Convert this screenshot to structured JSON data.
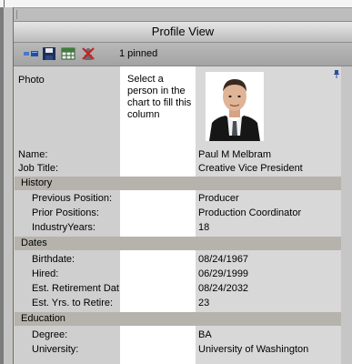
{
  "window": {
    "title": "Profile View"
  },
  "toolbar": {
    "pinned_label": "1 pinned"
  },
  "compare_column": {
    "instruction": "Select a person in the chart to fill this column"
  },
  "profile": {
    "photo_label": "Photo",
    "fields": [
      {
        "label": "Name:",
        "value": "Paul M Melbram"
      },
      {
        "label": "Job Title:",
        "value": "Creative Vice President"
      }
    ],
    "sections": [
      {
        "title": "History",
        "rows": [
          {
            "label": "Previous Position:",
            "value": "Producer"
          },
          {
            "label": "Prior Positions:",
            "value": "Production Coordinator"
          },
          {
            "label": "IndustryYears:",
            "value": "18"
          }
        ]
      },
      {
        "title": "Dates",
        "rows": [
          {
            "label": "Birthdate:",
            "value": "08/24/1967"
          },
          {
            "label": "Hired:",
            "value": "06/29/1999"
          },
          {
            "label": "Est. Retirement Dat",
            "value": "08/24/2032"
          },
          {
            "label": "Est. Yrs. to Retire:",
            "value": "23"
          }
        ]
      },
      {
        "title": "Education",
        "rows": [
          {
            "label": "Degree:",
            "value": "BA"
          },
          {
            "label": "University:",
            "value": "University of Washington"
          }
        ]
      }
    ]
  },
  "icons": {
    "toolbar": [
      "collapse-icon",
      "save-icon",
      "grid-icon",
      "clear-icon"
    ],
    "pin": "pin-icon"
  }
}
